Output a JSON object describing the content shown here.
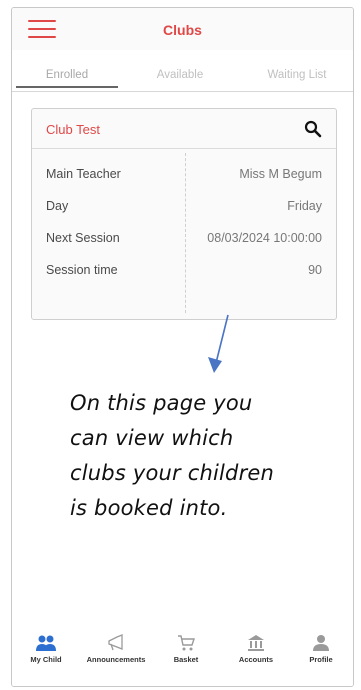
{
  "header": {
    "title": "Clubs"
  },
  "tabs": [
    {
      "label": "Enrolled"
    },
    {
      "label": "Available"
    },
    {
      "label": "Waiting List"
    }
  ],
  "club": {
    "name": "Club Test",
    "rows": [
      {
        "label": "Main Teacher",
        "value": "Miss M Begum"
      },
      {
        "label": "Day",
        "value": "Friday"
      },
      {
        "label": "Next Session",
        "value": "08/03/2024 10:00:00"
      },
      {
        "label": "Session time",
        "value": "90"
      }
    ]
  },
  "note": {
    "lines": [
      "On this page you",
      "can view which",
      "clubs your children",
      "is booked into."
    ]
  },
  "nav": [
    {
      "label": "My Child",
      "icon": "people-icon"
    },
    {
      "label": "Announcements",
      "icon": "megaphone-icon"
    },
    {
      "label": "Basket",
      "icon": "cart-icon"
    },
    {
      "label": "Accounts",
      "icon": "bank-icon"
    },
    {
      "label": "Profile",
      "icon": "person-icon"
    }
  ],
  "colors": {
    "accent": "#e04848",
    "nav_active": "#2c6fd1",
    "nav_inactive": "#9a9a9a",
    "arrow": "#4a74c4"
  }
}
